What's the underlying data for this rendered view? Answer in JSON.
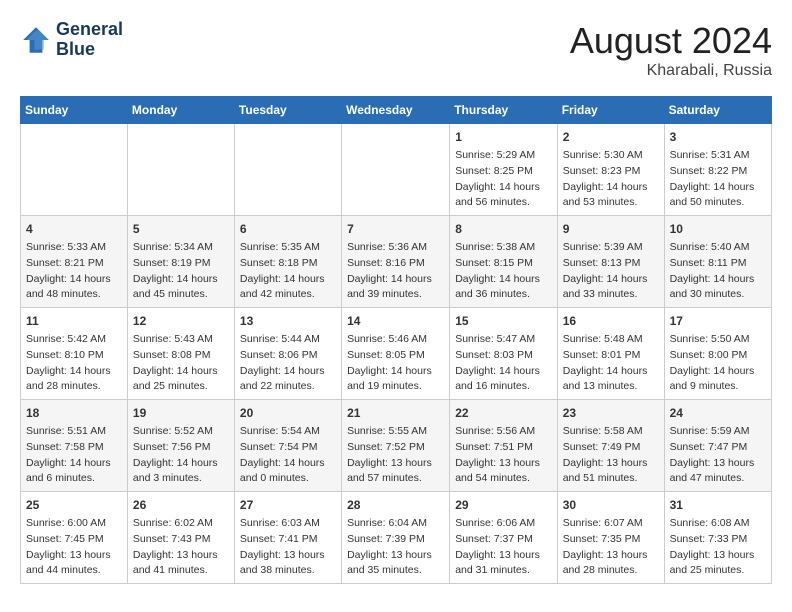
{
  "header": {
    "logo_line1": "General",
    "logo_line2": "Blue",
    "month_year": "August 2024",
    "location": "Kharabali, Russia"
  },
  "days_of_week": [
    "Sunday",
    "Monday",
    "Tuesday",
    "Wednesday",
    "Thursday",
    "Friday",
    "Saturday"
  ],
  "weeks": [
    [
      {
        "day": "",
        "info": ""
      },
      {
        "day": "",
        "info": ""
      },
      {
        "day": "",
        "info": ""
      },
      {
        "day": "",
        "info": ""
      },
      {
        "day": "1",
        "info": "Sunrise: 5:29 AM\nSunset: 8:25 PM\nDaylight: 14 hours\nand 56 minutes."
      },
      {
        "day": "2",
        "info": "Sunrise: 5:30 AM\nSunset: 8:23 PM\nDaylight: 14 hours\nand 53 minutes."
      },
      {
        "day": "3",
        "info": "Sunrise: 5:31 AM\nSunset: 8:22 PM\nDaylight: 14 hours\nand 50 minutes."
      }
    ],
    [
      {
        "day": "4",
        "info": "Sunrise: 5:33 AM\nSunset: 8:21 PM\nDaylight: 14 hours\nand 48 minutes."
      },
      {
        "day": "5",
        "info": "Sunrise: 5:34 AM\nSunset: 8:19 PM\nDaylight: 14 hours\nand 45 minutes."
      },
      {
        "day": "6",
        "info": "Sunrise: 5:35 AM\nSunset: 8:18 PM\nDaylight: 14 hours\nand 42 minutes."
      },
      {
        "day": "7",
        "info": "Sunrise: 5:36 AM\nSunset: 8:16 PM\nDaylight: 14 hours\nand 39 minutes."
      },
      {
        "day": "8",
        "info": "Sunrise: 5:38 AM\nSunset: 8:15 PM\nDaylight: 14 hours\nand 36 minutes."
      },
      {
        "day": "9",
        "info": "Sunrise: 5:39 AM\nSunset: 8:13 PM\nDaylight: 14 hours\nand 33 minutes."
      },
      {
        "day": "10",
        "info": "Sunrise: 5:40 AM\nSunset: 8:11 PM\nDaylight: 14 hours\nand 30 minutes."
      }
    ],
    [
      {
        "day": "11",
        "info": "Sunrise: 5:42 AM\nSunset: 8:10 PM\nDaylight: 14 hours\nand 28 minutes."
      },
      {
        "day": "12",
        "info": "Sunrise: 5:43 AM\nSunset: 8:08 PM\nDaylight: 14 hours\nand 25 minutes."
      },
      {
        "day": "13",
        "info": "Sunrise: 5:44 AM\nSunset: 8:06 PM\nDaylight: 14 hours\nand 22 minutes."
      },
      {
        "day": "14",
        "info": "Sunrise: 5:46 AM\nSunset: 8:05 PM\nDaylight: 14 hours\nand 19 minutes."
      },
      {
        "day": "15",
        "info": "Sunrise: 5:47 AM\nSunset: 8:03 PM\nDaylight: 14 hours\nand 16 minutes."
      },
      {
        "day": "16",
        "info": "Sunrise: 5:48 AM\nSunset: 8:01 PM\nDaylight: 14 hours\nand 13 minutes."
      },
      {
        "day": "17",
        "info": "Sunrise: 5:50 AM\nSunset: 8:00 PM\nDaylight: 14 hours\nand 9 minutes."
      }
    ],
    [
      {
        "day": "18",
        "info": "Sunrise: 5:51 AM\nSunset: 7:58 PM\nDaylight: 14 hours\nand 6 minutes."
      },
      {
        "day": "19",
        "info": "Sunrise: 5:52 AM\nSunset: 7:56 PM\nDaylight: 14 hours\nand 3 minutes."
      },
      {
        "day": "20",
        "info": "Sunrise: 5:54 AM\nSunset: 7:54 PM\nDaylight: 14 hours\nand 0 minutes."
      },
      {
        "day": "21",
        "info": "Sunrise: 5:55 AM\nSunset: 7:52 PM\nDaylight: 13 hours\nand 57 minutes."
      },
      {
        "day": "22",
        "info": "Sunrise: 5:56 AM\nSunset: 7:51 PM\nDaylight: 13 hours\nand 54 minutes."
      },
      {
        "day": "23",
        "info": "Sunrise: 5:58 AM\nSunset: 7:49 PM\nDaylight: 13 hours\nand 51 minutes."
      },
      {
        "day": "24",
        "info": "Sunrise: 5:59 AM\nSunset: 7:47 PM\nDaylight: 13 hours\nand 47 minutes."
      }
    ],
    [
      {
        "day": "25",
        "info": "Sunrise: 6:00 AM\nSunset: 7:45 PM\nDaylight: 13 hours\nand 44 minutes."
      },
      {
        "day": "26",
        "info": "Sunrise: 6:02 AM\nSunset: 7:43 PM\nDaylight: 13 hours\nand 41 minutes."
      },
      {
        "day": "27",
        "info": "Sunrise: 6:03 AM\nSunset: 7:41 PM\nDaylight: 13 hours\nand 38 minutes."
      },
      {
        "day": "28",
        "info": "Sunrise: 6:04 AM\nSunset: 7:39 PM\nDaylight: 13 hours\nand 35 minutes."
      },
      {
        "day": "29",
        "info": "Sunrise: 6:06 AM\nSunset: 7:37 PM\nDaylight: 13 hours\nand 31 minutes."
      },
      {
        "day": "30",
        "info": "Sunrise: 6:07 AM\nSunset: 7:35 PM\nDaylight: 13 hours\nand 28 minutes."
      },
      {
        "day": "31",
        "info": "Sunrise: 6:08 AM\nSunset: 7:33 PM\nDaylight: 13 hours\nand 25 minutes."
      }
    ]
  ]
}
